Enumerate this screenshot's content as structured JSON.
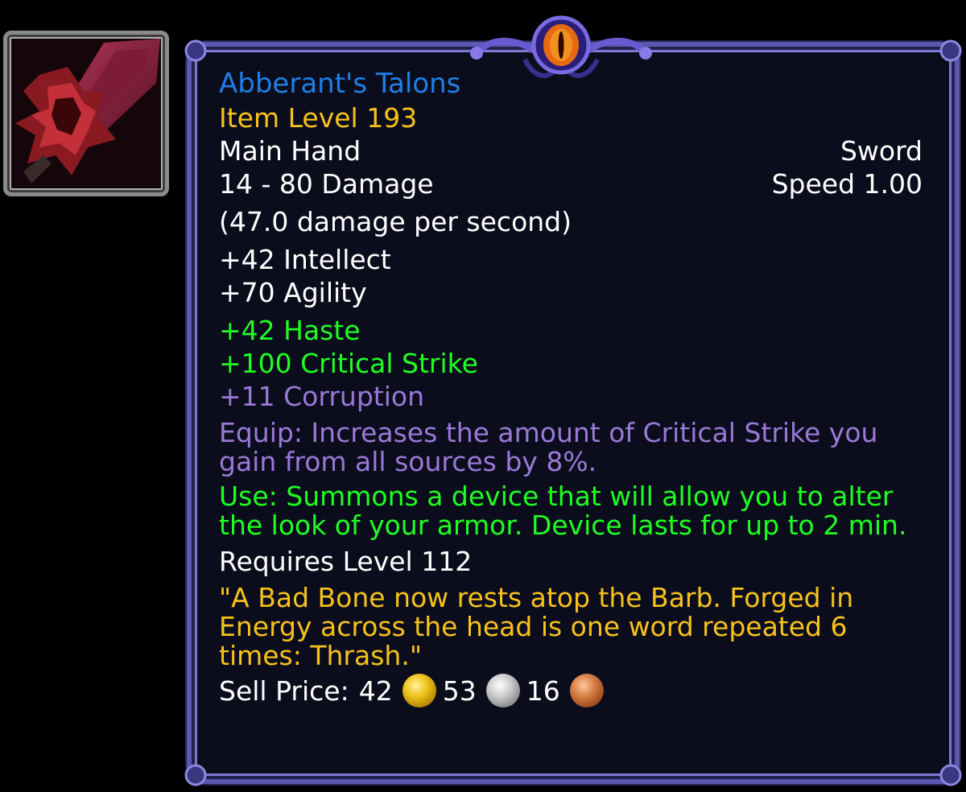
{
  "item": {
    "name": "Abberant's Talons",
    "item_level": "Item Level 193",
    "slot": "Main Hand",
    "type": "Sword",
    "damage": "14 - 80 Damage",
    "speed": "Speed 1.00",
    "dps": "(47.0 damage per second)",
    "stats": [
      "+42 Intellect",
      "+70 Agility"
    ],
    "secondary_stats": [
      "+42 Haste",
      "+100 Critical Strike"
    ],
    "corruption": "+11 Corruption",
    "equip_effect": "Equip: Increases the amount of Critical Strike you gain from all sources by 8%.",
    "use_effect": "Use: Summons a device that will allow you to alter the look of your armor. Device lasts for up to 2 min.",
    "requires_level": "Requires Level 112",
    "flavor_text": "\"A Bad Bone now rests atop the Barb. Forged in Energy across the head is one word repeated 6 times: Thrash.\"",
    "sell_price": {
      "label": "Sell Price:",
      "gold": "42",
      "silver": "53",
      "copper": "16"
    }
  },
  "icons": {
    "item_icon": "sword-icon",
    "ornament": "eye-icon",
    "gold_coin": "gold-coin-icon",
    "silver_coin": "silver-coin-icon",
    "copper_coin": "copper-coin-icon"
  },
  "colors": {
    "title": "#1f7fe6",
    "item_level": "#f7c21a",
    "green_text": "#1fff22",
    "corruption": "#9a79d8",
    "border": "#5a58b0",
    "background": "#0b0d1c"
  }
}
